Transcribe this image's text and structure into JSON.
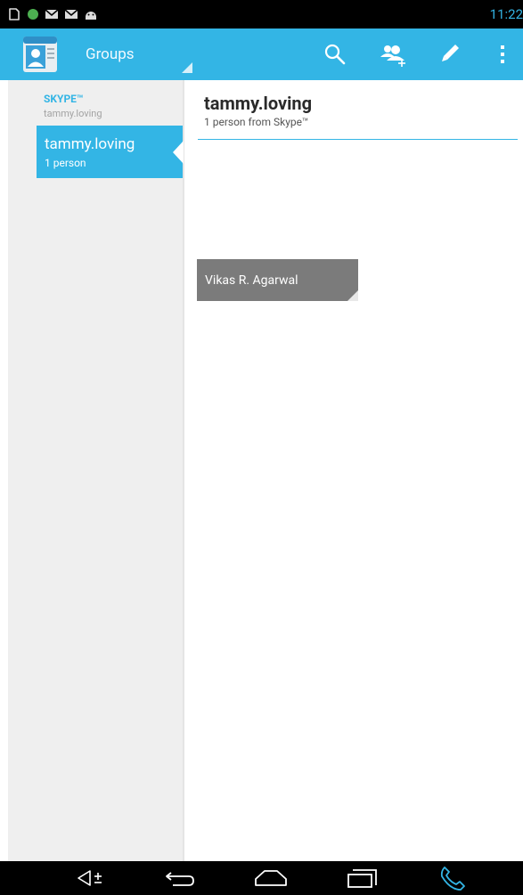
{
  "status_bar": {
    "time": "11:22",
    "icons": [
      "notification-icon",
      "circle-notification-icon",
      "gmail-icon",
      "gmail-icon",
      "android-icon"
    ]
  },
  "action_bar": {
    "title": "Groups",
    "actions": [
      "search-icon",
      "add-contact-icon",
      "edit-icon",
      "overflow-menu-icon"
    ]
  },
  "sidebar": {
    "account_type": "SKYPE™",
    "account_name": "tammy.loving",
    "groups": [
      {
        "title": "tammy.loving",
        "subtitle": "1 person",
        "selected": true
      }
    ]
  },
  "detail": {
    "title": "tammy.loving",
    "subtitle": "1 person from Skype™",
    "members": [
      {
        "name": "Vikas R. Agarwal"
      }
    ]
  },
  "nav_bar": {
    "buttons": [
      "volume-icon",
      "back-icon",
      "home-icon",
      "recent-apps-icon",
      "phone-icon"
    ]
  },
  "colors": {
    "accent": "#33b5e5",
    "sidebar_bg": "#efefef",
    "tile_bg": "#7b7b7b"
  }
}
